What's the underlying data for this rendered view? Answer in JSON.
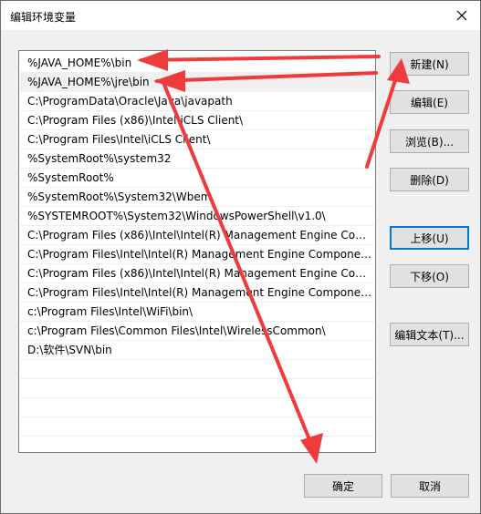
{
  "window": {
    "title": "编辑环境变量"
  },
  "list": {
    "items": [
      "%JAVA_HOME%\\bin",
      "%JAVA_HOME%\\jre\\bin",
      "C:\\ProgramData\\Oracle\\Java\\javapath",
      "C:\\Program Files (x86)\\Intel\\iCLS Client\\",
      "C:\\Program Files\\Intel\\iCLS Client\\",
      "%SystemRoot%\\system32",
      "%SystemRoot%",
      "%SystemRoot%\\System32\\Wbem",
      "%SYSTEMROOT%\\System32\\WindowsPowerShell\\v1.0\\",
      "C:\\Program Files (x86)\\Intel\\Intel(R) Management Engine Comp...",
      "C:\\Program Files\\Intel\\Intel(R) Management Engine Component...",
      "C:\\Program Files (x86)\\Intel\\Intel(R) Management Engine Comp...",
      "C:\\Program Files\\Intel\\Intel(R) Management Engine Component...",
      "c:\\Program Files\\Intel\\WiFi\\bin\\",
      "c:\\Program Files\\Common Files\\Intel\\WirelessCommon\\",
      "D:\\软件\\SVN\\bin"
    ]
  },
  "buttons": {
    "new": "新建(N)",
    "edit": "编辑(E)",
    "browse": "浏览(B)...",
    "delete": "删除(D)",
    "move_up": "上移(U)",
    "move_down": "下移(O)",
    "edit_text": "编辑文本(T)...",
    "ok": "确定",
    "cancel": "取消"
  },
  "icons": {
    "close": "close-icon"
  },
  "colors": {
    "annotation_arrow": "#ef3b3b",
    "selection_border": "#0078d7"
  }
}
